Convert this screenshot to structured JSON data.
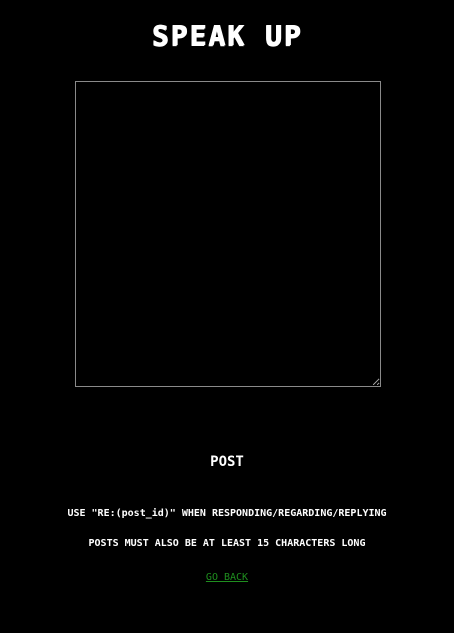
{
  "page": {
    "title": "SPEAK UP"
  },
  "form": {
    "post_text_value": "",
    "post_button_label": "POST"
  },
  "notices": {
    "reply_hint": "USE \"RE:(post_id)\" WHEN RESPONDING/REGARDING/REPLYING",
    "length_rule": "POSTS MUST ALSO BE AT LEAST 15 CHARACTERS LONG"
  },
  "nav": {
    "go_back_label": "GO BACK"
  },
  "colors": {
    "background": "#000000",
    "text": "#ffffff",
    "link": "#1f8f1f",
    "textarea_border": "#8a8a8a"
  }
}
